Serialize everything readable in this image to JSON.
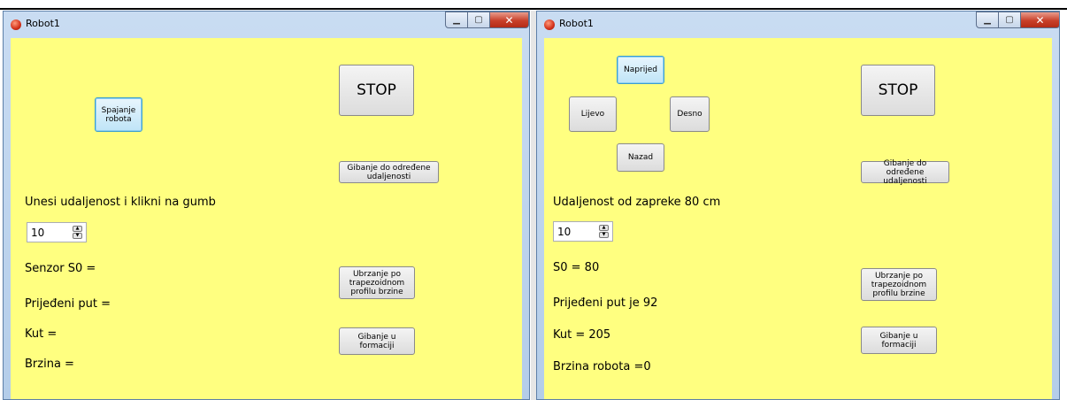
{
  "left": {
    "title": "Robot1",
    "connect_label": "Spajanje robota",
    "stop_label": "STOP",
    "move_distance_label": "Gibanje do određene udaljenosti",
    "prompt_label": "Unesi udaljenost i klikni na gumb",
    "spin_value": "10",
    "sensor_label": "Senzor S0 =",
    "trapezoid_label": "Ubrzanje po trapezoidnom profilu brzine",
    "distance_label": "Prijeđeni put =",
    "angle_label": "Kut =",
    "formation_label": "Gibanje u formaciji",
    "speed_label": "Brzina ="
  },
  "right": {
    "title": "Robot1",
    "forward_label": "Naprijed",
    "left_label": "Lijevo",
    "right_label": "Desno",
    "back_label": "Nazad",
    "stop_label": "STOP",
    "move_distance_label": "Gibanje do određene udaljenosti",
    "obstacle_label": "Udaljenost od zapreke 80 cm",
    "spin_value": "10",
    "sensor_label": "S0 = 80",
    "trapezoid_label": "Ubrzanje po trapezoidnom profilu brzine",
    "distance_label": "Prijeđeni put je 92",
    "angle_label": "Kut = 205",
    "formation_label": "Gibanje u formaciji",
    "speed_label": "Brzina robota =0"
  },
  "icons": {
    "app": "robot-app-icon",
    "minimize": "minimize-icon",
    "maximize": "maximize-icon",
    "close": "close-icon",
    "spin_up": "arrow-up-icon",
    "spin_down": "arrow-down-icon"
  },
  "colors": {
    "client_bg": "#ffff80",
    "focus_button": "#bfe4f7",
    "close_button": "#c8402a"
  }
}
